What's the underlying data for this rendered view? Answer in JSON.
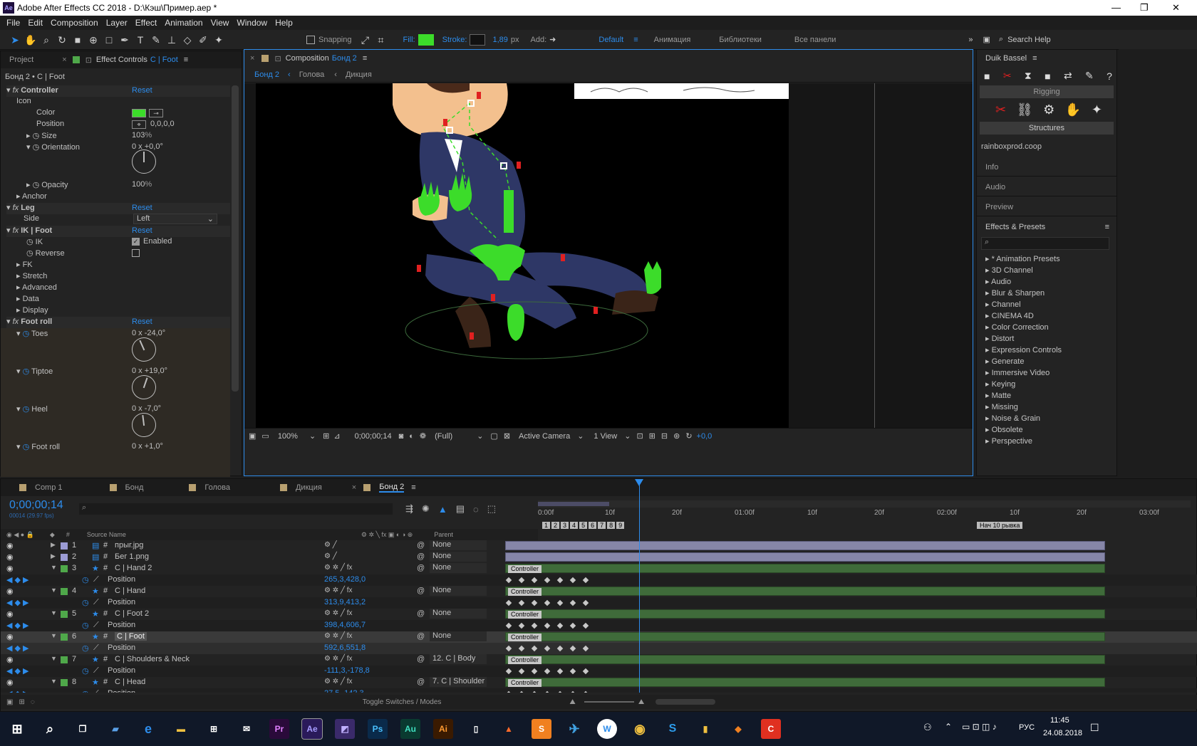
{
  "window": {
    "title": "Adobe After Effects CC 2018 - D:\\Кэш\\Пример.aep *",
    "app_badge": "Ae"
  },
  "menu": [
    "File",
    "Edit",
    "Composition",
    "Layer",
    "Effect",
    "Animation",
    "View",
    "Window",
    "Help"
  ],
  "toolbar": {
    "snapping": "Snapping",
    "fill": "Fill:",
    "fill_color": "#3cdc2a",
    "stroke": "Stroke:",
    "stroke_width": "1,89",
    "stroke_unit": "px",
    "add": "Add:",
    "workspaces": [
      "Default",
      "Анимация",
      "Библиотеки",
      "Все панели"
    ],
    "search_help": "Search Help"
  },
  "left_panel": {
    "tabs": [
      "Project",
      "Effect Controls",
      "C | Foot"
    ],
    "breadcrumb": "Бонд 2 • C | Foot",
    "rows": {
      "controller": "Controller",
      "reset": "Reset",
      "icon": "Icon",
      "color": "Color",
      "position": "Position",
      "position_val": "0,0,0,0",
      "size": "Size",
      "size_val": "103",
      "pct": "%",
      "orientation": "Orientation",
      "orientation_val": "0 x +0,0°",
      "opacity": "Opacity",
      "opacity_val": "100",
      "anchor": "Anchor",
      "leg": "Leg",
      "side": "Side",
      "side_val": "Left",
      "ikfoot": "IK | Foot",
      "ik": "IK",
      "enabled": "Enabled",
      "reverse": "Reverse",
      "fk": "FK",
      "stretch": "Stretch",
      "advanced": "Advanced",
      "data": "Data",
      "display": "Display",
      "footroll": "Foot roll",
      "toes": "Toes",
      "toes_val": "0 x -24,0°",
      "tiptoe": "Tiptoe",
      "tiptoe_val": "0 x +19,0°",
      "heel": "Heel",
      "heel_val": "0 x -7,0°",
      "footroll2": "Foot roll",
      "footroll2_val": "0 x +1,0°"
    }
  },
  "comp_panel": {
    "tab": "Composition",
    "tab_name": "Бонд 2",
    "crumbs": [
      "Бонд 2",
      "Голова",
      "Дикция"
    ],
    "footer": {
      "zoom": "100%",
      "timecode": "0;00;00;14",
      "res": "(Full)",
      "camera": "Active Camera",
      "views": "1 View",
      "exposure": "+0,0"
    }
  },
  "right_panel": {
    "title": "Duik Bassel",
    "rigging": "Rigging",
    "structures": "Structures",
    "site": "rainboxprod.coop",
    "sections": [
      "Info",
      "Audio",
      "Preview"
    ],
    "effects_title": "Effects & Presets",
    "effects": [
      "* Animation Presets",
      "3D Channel",
      "Audio",
      "Blur & Sharpen",
      "Channel",
      "CINEMA 4D",
      "Color Correction",
      "Distort",
      "Expression Controls",
      "Generate",
      "Immersive Video",
      "Keying",
      "Matte",
      "Missing",
      "Noise & Grain",
      "Obsolete",
      "Perspective"
    ]
  },
  "timeline": {
    "tabs": [
      "Comp 1",
      "Бонд",
      "Голова",
      "Дикция",
      "Бонд 2"
    ],
    "timecode": "0;00;00;14",
    "fps": "00014 (29.97 fps)",
    "col_source": "Source Name",
    "col_parent": "Parent",
    "ruler": [
      "0:00f",
      "10f",
      "20f",
      "01:00f",
      "10f",
      "20f",
      "02:00f",
      "10f",
      "20f",
      "03:00f"
    ],
    "markers": [
      "1",
      "2",
      "3",
      "4",
      "5",
      "6",
      "7",
      "8",
      "9"
    ],
    "marker_label": "Нач 10 рывка",
    "toggle": "Toggle Switches / Modes",
    "chip": "Controller",
    "layers": [
      {
        "num": "1",
        "name": "прыг.jpg",
        "parent": "None",
        "color": "#9b9bd4"
      },
      {
        "num": "2",
        "name": "Бег 1.png",
        "parent": "None",
        "color": "#9b9bd4"
      },
      {
        "num": "3",
        "name": "C | Hand 2",
        "parent": "None",
        "color": "#4fa84a",
        "prop": "Position",
        "val": "265,3,428,0"
      },
      {
        "num": "4",
        "name": "C | Hand",
        "parent": "None",
        "color": "#4fa84a",
        "prop": "Position",
        "val": "313,9,413,2"
      },
      {
        "num": "5",
        "name": "C | Foot 2",
        "parent": "None",
        "color": "#4fa84a",
        "prop": "Position",
        "val": "398,4,606,7"
      },
      {
        "num": "6",
        "name": "C | Foot",
        "parent": "None",
        "color": "#4fa84a",
        "prop": "Position",
        "val": "592,6,551,8"
      },
      {
        "num": "7",
        "name": "C | Shoulders & Neck",
        "parent": "12. C | Body",
        "color": "#4fa84a",
        "prop": "Position",
        "val": "-111,3,-178,8"
      },
      {
        "num": "8",
        "name": "C | Head",
        "parent": "7. C | Shoulder",
        "color": "#4fa84a",
        "prop": "Position",
        "val": "27,5,-142,3"
      }
    ]
  },
  "taskbar": {
    "lang": "РУС",
    "time": "11:45",
    "date": "24.08.2018"
  }
}
